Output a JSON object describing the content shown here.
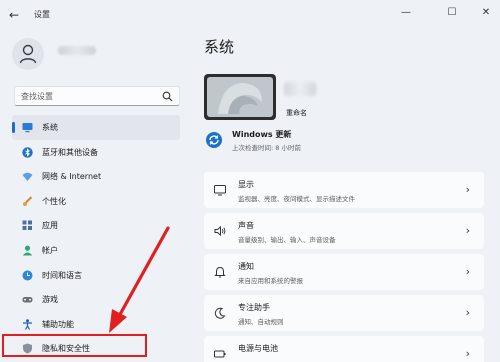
{
  "app": {
    "title": "设置"
  },
  "window": {
    "back": "←",
    "minimize": "—",
    "maximize": "☐",
    "close": "✕"
  },
  "user": {
    "name_blurred": true
  },
  "search": {
    "placeholder": "查找设置"
  },
  "sidebar": {
    "items": [
      {
        "label": "系统",
        "icon": "monitor-icon",
        "active": true
      },
      {
        "label": "蓝牙和其他设备",
        "icon": "bluetooth-icon"
      },
      {
        "label": "网络 & Internet",
        "icon": "wifi-icon"
      },
      {
        "label": "个性化",
        "icon": "brush-icon"
      },
      {
        "label": "应用",
        "icon": "apps-icon"
      },
      {
        "label": "帐户",
        "icon": "person-icon"
      },
      {
        "label": "时间和语言",
        "icon": "globe-clock-icon"
      },
      {
        "label": "游戏",
        "icon": "gamepad-icon"
      },
      {
        "label": "辅助功能",
        "icon": "accessibility-icon"
      },
      {
        "label": "隐私和安全性",
        "icon": "shield-icon",
        "highlighted": true
      }
    ]
  },
  "main": {
    "title": "系统",
    "device": {
      "rename": "重命名"
    },
    "windows_update": {
      "title": "Windows 更新",
      "subtitle": "上次检查时间: 8 小时前"
    },
    "cards": [
      {
        "title": "显示",
        "subtitle": "监视器、亮度、夜间模式、显示描述文件",
        "icon": "display-icon"
      },
      {
        "title": "声音",
        "subtitle": "音量级别、输出、输入、声音设备",
        "icon": "speaker-icon"
      },
      {
        "title": "通知",
        "subtitle": "来自应用和系统的警报",
        "icon": "bell-icon"
      },
      {
        "title": "专注助手",
        "subtitle": "通知、自动规则",
        "icon": "moon-icon"
      },
      {
        "title": "电源与电池",
        "subtitle": "",
        "icon": "battery-icon"
      }
    ]
  },
  "colors": {
    "accent": "#1a6dc9",
    "annotation": "#e02020"
  }
}
